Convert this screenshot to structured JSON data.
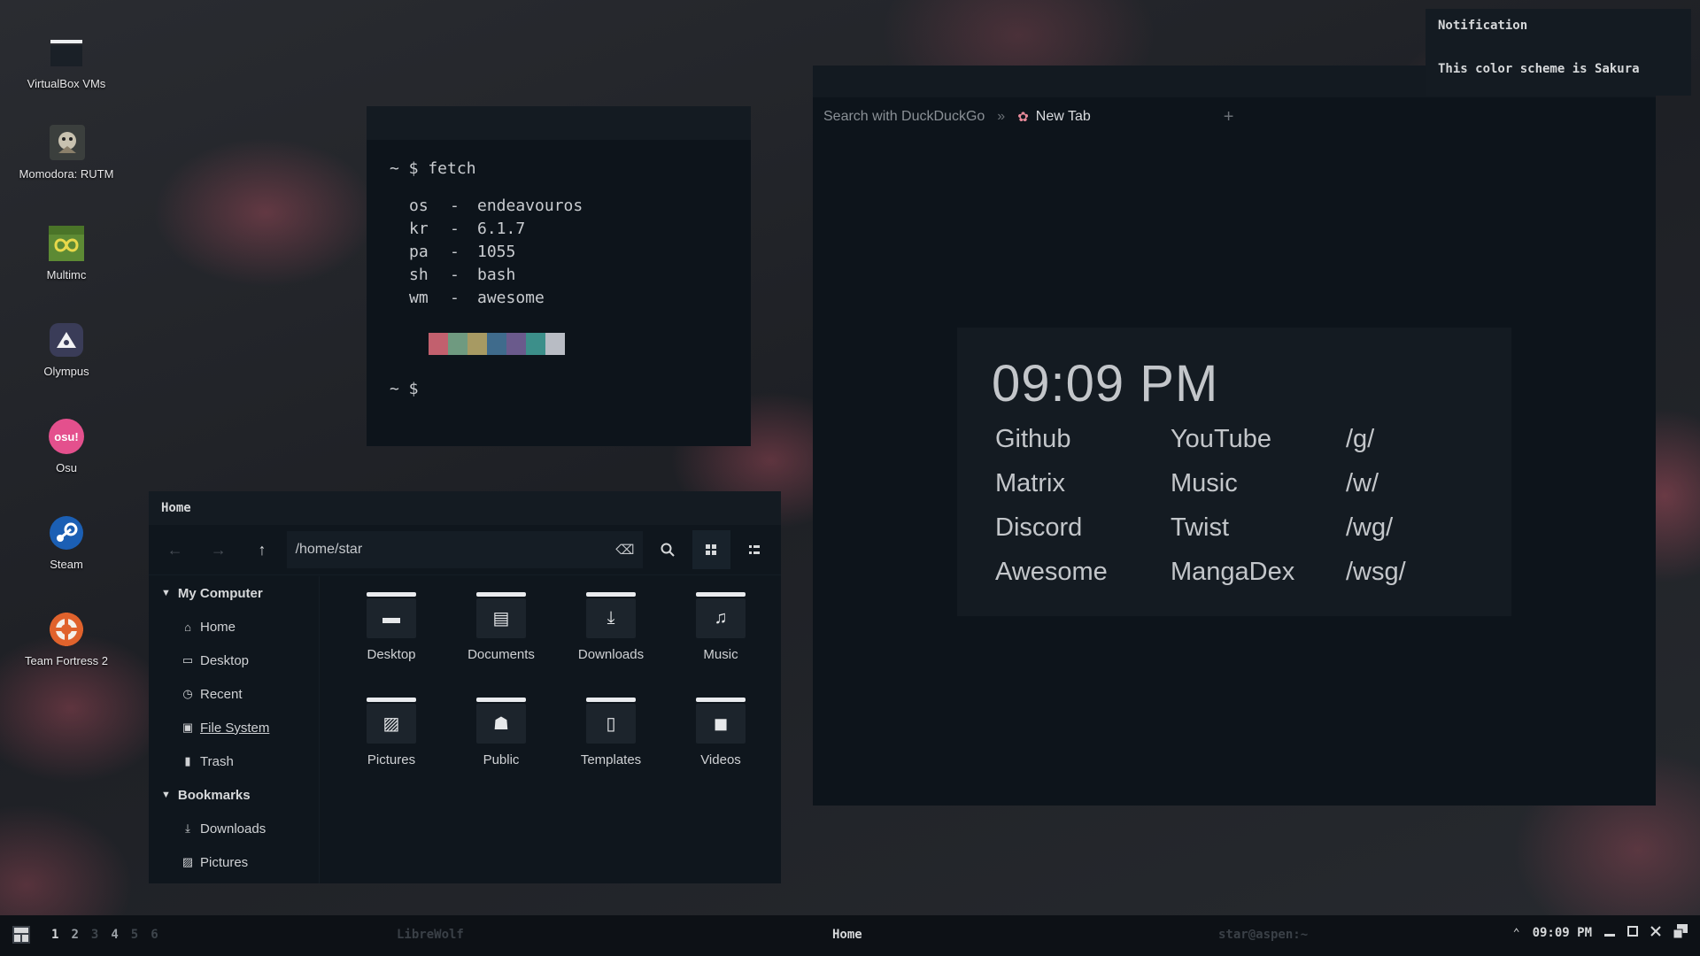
{
  "desktop": {
    "icons": [
      {
        "label": "VirtualBox VMs",
        "icon": "folder-icon"
      },
      {
        "label": "Momodora: RUTM",
        "icon": "momodora-icon"
      },
      {
        "label": "Multimc",
        "icon": "multimc-icon"
      },
      {
        "label": "Olympus",
        "icon": "olympus-icon"
      },
      {
        "label": "Osu",
        "icon": "osu-icon",
        "icon_text": "osu!"
      },
      {
        "label": "Steam",
        "icon": "steam-icon"
      },
      {
        "label": "Team Fortress 2",
        "icon": "tf2-icon"
      }
    ]
  },
  "terminal": {
    "command_line": "~ $ fetch",
    "fetch": [
      {
        "key": "os",
        "sep": "-",
        "value": "endeavouros"
      },
      {
        "key": "kr",
        "sep": "-",
        "value": "6.1.7"
      },
      {
        "key": "pa",
        "sep": "-",
        "value": "1055"
      },
      {
        "key": "sh",
        "sep": "-",
        "value": "bash"
      },
      {
        "key": "wm",
        "sep": "-",
        "value": "awesome"
      }
    ],
    "palette": [
      "#0d141b",
      "#c2606e",
      "#6f9a80",
      "#a79a63",
      "#3f6b8c",
      "#6a5a8c",
      "#3c8f8a",
      "#b8bcc4"
    ],
    "prompt": "~ $"
  },
  "file_manager": {
    "title": "Home",
    "path": "/home/star",
    "sidebar": {
      "sections": [
        {
          "heading": "My Computer",
          "items": [
            {
              "label": "Home",
              "icon": "home-icon",
              "glyph": "⌂"
            },
            {
              "label": "Desktop",
              "icon": "desktop-icon",
              "glyph": "▭"
            },
            {
              "label": "Recent",
              "icon": "clock-icon",
              "glyph": "◷"
            },
            {
              "label": "File System",
              "icon": "drive-icon",
              "glyph": "▣"
            },
            {
              "label": "Trash",
              "icon": "trash-icon",
              "glyph": "▮"
            }
          ]
        },
        {
          "heading": "Bookmarks",
          "items": [
            {
              "label": "Downloads",
              "icon": "download-icon",
              "glyph": "⤓"
            },
            {
              "label": "Pictures",
              "icon": "image-icon",
              "glyph": "▨"
            }
          ]
        }
      ]
    },
    "folders": [
      {
        "label": "Desktop",
        "icon": "desktop-folder-icon",
        "glyph": "▬"
      },
      {
        "label": "Documents",
        "icon": "document-folder-icon",
        "glyph": "▤"
      },
      {
        "label": "Downloads",
        "icon": "download-folder-icon",
        "glyph": "⤓"
      },
      {
        "label": "Music",
        "icon": "music-folder-icon",
        "glyph": "♫"
      },
      {
        "label": "Pictures",
        "icon": "pictures-folder-icon",
        "glyph": "▨"
      },
      {
        "label": "Public",
        "icon": "public-folder-icon",
        "glyph": "☗"
      },
      {
        "label": "Templates",
        "icon": "templates-folder-icon",
        "glyph": "▯"
      },
      {
        "label": "Videos",
        "icon": "videos-folder-icon",
        "glyph": "◼"
      }
    ]
  },
  "browser": {
    "search_hint": "Search with DuckDuckGo",
    "separator": "»",
    "tab_label": "New Tab",
    "new_tab": "+",
    "startpage": {
      "time": "09:09 PM",
      "links": [
        [
          "Github",
          "YouTube",
          "/g/"
        ],
        [
          "Matrix",
          "Music",
          "/w/"
        ],
        [
          "Discord",
          "Twist",
          "/wg/"
        ],
        [
          "Awesome",
          "MangaDex",
          "/wsg/"
        ]
      ]
    }
  },
  "notification": {
    "title": "Notification",
    "body": "This color scheme is Sakura"
  },
  "taskbar": {
    "tags": [
      {
        "label": "1",
        "active": true
      },
      {
        "label": "2",
        "active": false,
        "occupied": true
      },
      {
        "label": "3",
        "active": false,
        "occupied": false
      },
      {
        "label": "4",
        "active": false,
        "occupied": true
      },
      {
        "label": "5",
        "active": false,
        "occupied": false
      },
      {
        "label": "6",
        "active": false,
        "occupied": false
      }
    ],
    "tasks": [
      {
        "label": "LibreWolf",
        "focused": false
      },
      {
        "label": "Home",
        "focused": true
      },
      {
        "label": "star@aspen:~",
        "focused": false
      }
    ],
    "clock": "09:09 PM"
  },
  "colors": {
    "accent": "#e88a9a",
    "window_bg": "#0d141b",
    "titlebar": "#141b22",
    "text": "#d6d8da"
  }
}
